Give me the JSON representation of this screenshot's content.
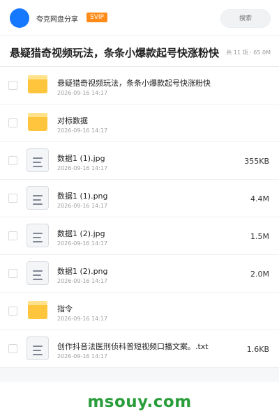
{
  "header": {
    "share_name": "夸克网盘分享",
    "badge": "SVIP",
    "search_placeholder": "搜索"
  },
  "folder": {
    "title": "悬疑猎奇视频玩法，条条小爆款起号快涨粉快",
    "meta": "共 11 项 · 65.0M"
  },
  "files": [
    {
      "type": "folder",
      "name": "悬疑猎奇视频玩法，条条小爆款起号快涨粉快",
      "date": "2026-09-16 14:17",
      "size": ""
    },
    {
      "type": "folder",
      "name": "对标数据",
      "date": "2026-09-16 14:17",
      "size": ""
    },
    {
      "type": "file",
      "name": "数据1 (1).jpg",
      "date": "2026-09-16 14:17",
      "size": "355KB"
    },
    {
      "type": "file",
      "name": "数据1 (1).png",
      "date": "2026-09-16 14:17",
      "size": "4.4M"
    },
    {
      "type": "file",
      "name": "数据1 (2).jpg",
      "date": "2026-09-16 14:17",
      "size": "1.5M"
    },
    {
      "type": "file",
      "name": "数据1 (2).png",
      "date": "2026-09-16 14:17",
      "size": "2.0M"
    },
    {
      "type": "folder",
      "name": "指令",
      "date": "2026-09-16 14:17",
      "size": ""
    },
    {
      "type": "file",
      "name": "创作抖音法医刑侦科普短视频口播文案。.txt",
      "date": "2026-09-16 14:17",
      "size": "1.6KB"
    }
  ],
  "watermark": "msouy.com",
  "colors": {
    "accent": "#1677ff",
    "badge": "#ff8c1a",
    "folder": "#ffc53d",
    "watermark": "#2a9d3b"
  }
}
